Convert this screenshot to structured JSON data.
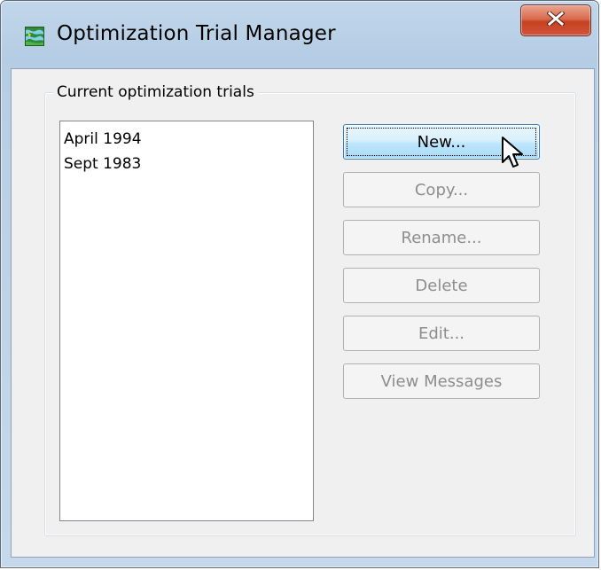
{
  "window": {
    "title": "Optimization Trial Manager",
    "app_icon": "map-icon",
    "close_icon": "close-icon"
  },
  "group": {
    "label": "Current optimization trials"
  },
  "trials": {
    "items": [
      "April 1994",
      "Sept 1983"
    ]
  },
  "buttons": {
    "new": "New...",
    "copy": "Copy...",
    "rename": "Rename...",
    "delete": "Delete",
    "edit": "Edit...",
    "view_messages": "View Messages"
  },
  "colors": {
    "close_button": "#c6401f",
    "default_button": "#bee6fd",
    "disabled_text": "#8d8d8d"
  }
}
